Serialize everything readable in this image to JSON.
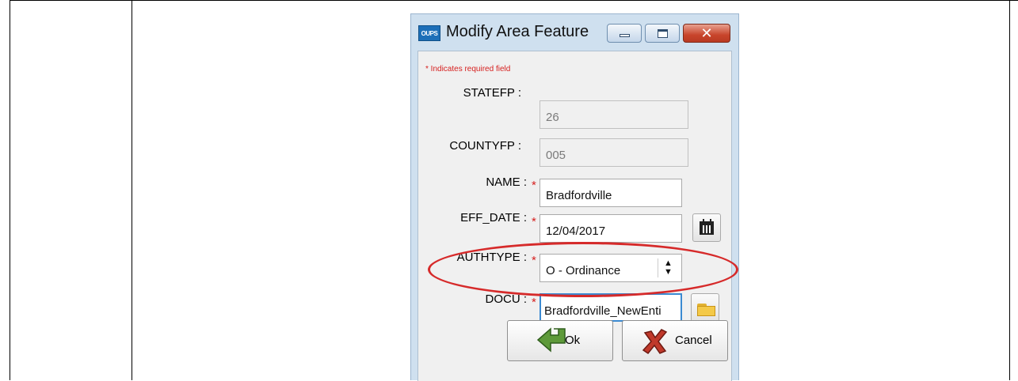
{
  "dialog": {
    "app_icon_text": "OUPS",
    "title": "Modify Area Feature",
    "close_glyph": "✕",
    "required_note": "* Indicates required field",
    "fields": {
      "statefp": {
        "label": "STATEFP :",
        "value": "26"
      },
      "countyfp": {
        "label": "COUNTYFP :",
        "value": "005"
      },
      "name": {
        "label": "NAME :",
        "value": "Bradfordville"
      },
      "eff_date": {
        "label": "EFF_DATE :",
        "value": "12/04/2017"
      },
      "authtype": {
        "label": "AUTHTYPE :",
        "value": "O - Ordinance"
      },
      "docu": {
        "label": "DOCU :",
        "value": "Bradfordville_NewEnti"
      }
    },
    "asterisk": "*",
    "buttons": {
      "ok": "Ok",
      "cancel": "Cancel"
    },
    "colors": {
      "required": "#d6201f",
      "highlight": "#d62a2a",
      "frame": "#cfe0ef"
    },
    "icons": [
      "oups-app-icon",
      "calendar-icon",
      "folder-icon",
      "ok-arrow-icon",
      "cancel-x-icon"
    ]
  }
}
